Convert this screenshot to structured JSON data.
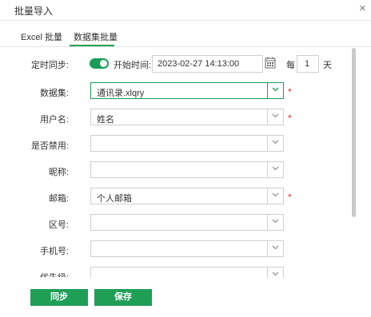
{
  "dialog": {
    "title": "批量导入",
    "close_glyph": "×"
  },
  "tabs": [
    {
      "label": "Excel 批量",
      "active": false
    },
    {
      "label": "数据集批量",
      "active": true
    }
  ],
  "accent_color": "#1a9d58",
  "required_color": "#e02b2b",
  "sync": {
    "label": "定时同步:",
    "enabled": true,
    "start_label": "开始时间:",
    "start_value": "2023-02-27 14:13:00",
    "every_label": "每",
    "interval_value": "1",
    "unit_label": "天"
  },
  "fields": [
    {
      "label": "数据集:",
      "value": "通讯录.xlqry",
      "required": true
    },
    {
      "label": "用户名:",
      "value": "姓名",
      "required": true
    },
    {
      "label": "是否禁用:",
      "value": "",
      "required": false
    },
    {
      "label": "昵称:",
      "value": "",
      "required": false
    },
    {
      "label": "邮箱:",
      "value": "个人邮箱",
      "required": true
    },
    {
      "label": "区号:",
      "value": "",
      "required": false
    },
    {
      "label": "手机号:",
      "value": "",
      "required": false
    },
    {
      "label": "优先级:",
      "value": "",
      "required": false
    }
  ],
  "required_mark": "*",
  "buttons": {
    "sync": "同步",
    "save": "保存"
  }
}
